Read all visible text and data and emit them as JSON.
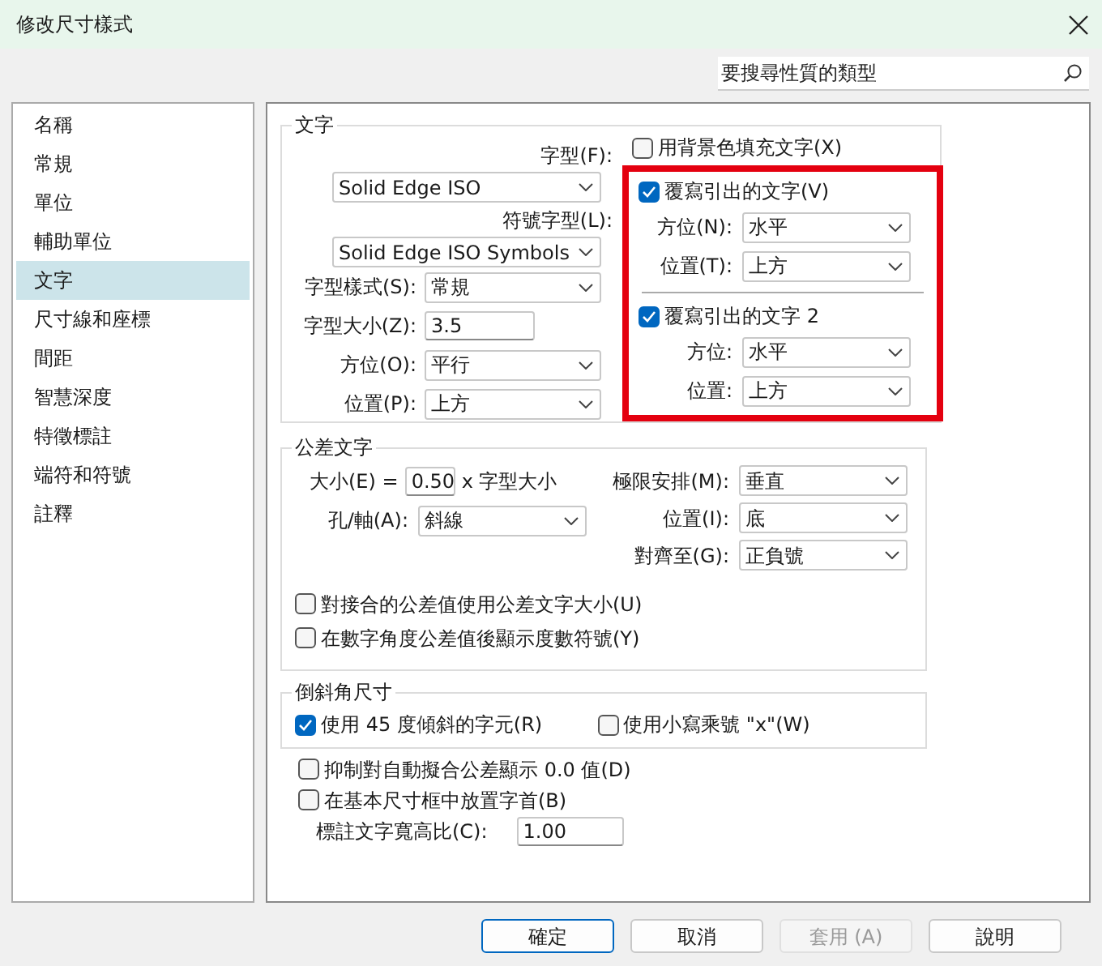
{
  "window": {
    "title": "修改尺寸樣式"
  },
  "search": {
    "placeholder": "要搜尋性質的類型"
  },
  "sidebar": {
    "items": [
      {
        "label": "名稱",
        "selected": false
      },
      {
        "label": "常規",
        "selected": false
      },
      {
        "label": "單位",
        "selected": false
      },
      {
        "label": "輔助單位",
        "selected": false
      },
      {
        "label": "文字",
        "selected": true
      },
      {
        "label": "尺寸線和座標",
        "selected": false
      },
      {
        "label": "間距",
        "selected": false
      },
      {
        "label": "智慧深度",
        "selected": false
      },
      {
        "label": "特徵標註",
        "selected": false
      },
      {
        "label": "端符和符號",
        "selected": false
      },
      {
        "label": "註釋",
        "selected": false
      }
    ]
  },
  "text_group": {
    "title": "文字",
    "font": {
      "label": "字型(F):",
      "value": "Solid Edge ISO"
    },
    "symbol_font": {
      "label": "符號字型(L):",
      "value": "Solid Edge ISO Symbols"
    },
    "fields": [
      {
        "kind": "select",
        "label": "字型樣式(S):",
        "value": "常規"
      },
      {
        "kind": "input",
        "label": "字型大小(Z):",
        "value": "3.5"
      },
      {
        "kind": "select",
        "label": "方位(O):",
        "value": "平行"
      },
      {
        "kind": "select",
        "label": "位置(P):",
        "value": "上方"
      }
    ],
    "fill_background": {
      "label": "用背景色填充文字(X)",
      "checked": false
    },
    "overrides": [
      {
        "label": "覆寫引出的文字(V)",
        "checked": true,
        "fields": [
          {
            "label": "方位(N):",
            "value": "水平"
          },
          {
            "label": "位置(T):",
            "value": "上方"
          }
        ]
      },
      {
        "label": "覆寫引出的文字 2",
        "checked": true,
        "fields": [
          {
            "label": "方位:",
            "value": "水平"
          },
          {
            "label": "位置:",
            "value": "上方"
          }
        ]
      }
    ]
  },
  "tolerance_group": {
    "title": "公差文字",
    "size": {
      "label": "大小(E) =",
      "value": "0.50",
      "suffix": "x 字型大小"
    },
    "hole_shaft": {
      "label": "孔/軸(A):",
      "value": "斜線"
    },
    "right_fields": [
      {
        "label": "極限安排(M):",
        "value": "垂直"
      },
      {
        "label": "位置(I):",
        "value": "底"
      },
      {
        "label": "對齊至(G):",
        "value": "正負號"
      }
    ],
    "checkboxes": [
      {
        "label": "對接合的公差值使用公差文字大小(U)",
        "checked": false
      },
      {
        "label": "在數字角度公差值後顯示度數符號(Y)",
        "checked": false
      }
    ]
  },
  "chamfer_group": {
    "title": "倒斜角尺寸",
    "checkboxes": [
      {
        "label": "使用 45 度傾斜的字元(R)",
        "checked": true
      },
      {
        "label": "使用小寫乘號 \"x\"(W)",
        "checked": false
      }
    ]
  },
  "options": [
    {
      "label": "抑制對自動擬合公差顯示 0.0 值(D)",
      "checked": false
    },
    {
      "label": "在基本尺寸框中放置字首(B)",
      "checked": false
    }
  ],
  "aspect_ratio": {
    "label": "標註文字寬高比(C):",
    "value": "1.00"
  },
  "buttons": [
    {
      "label": "確定",
      "default": true,
      "disabled": false
    },
    {
      "label": "取消",
      "default": false,
      "disabled": false
    },
    {
      "label": "套用 (A)",
      "default": false,
      "disabled": true
    },
    {
      "label": "說明",
      "default": false,
      "disabled": false
    }
  ]
}
